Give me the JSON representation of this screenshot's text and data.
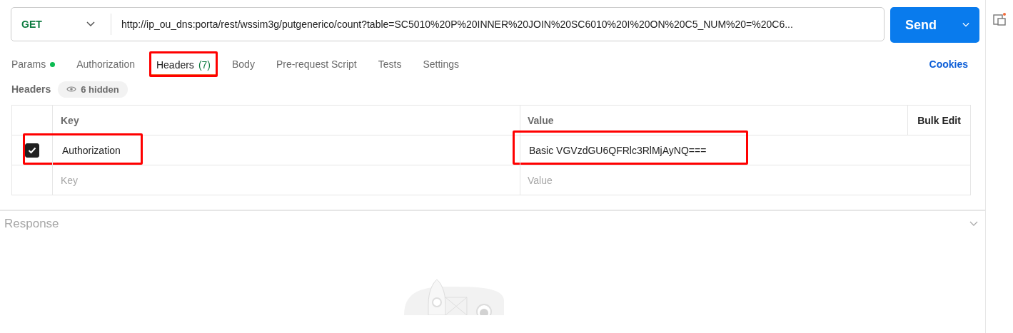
{
  "request": {
    "method": "GET",
    "url": "http://ip_ou_dns:porta/rest/wssim3g/putgenerico/count?table=SC5010%20P%20INNER%20JOIN%20SC6010%20I%20ON%20C5_NUM%20=%20C6...",
    "send": "Send"
  },
  "tabs": [
    {
      "label": "Params",
      "dot": true,
      "selected": false
    },
    {
      "label": "Authorization",
      "dot": false,
      "selected": false
    },
    {
      "label": "Headers",
      "count": "(7)",
      "dot": false,
      "selected": true,
      "highlighted": true
    },
    {
      "label": "Body",
      "dot": false,
      "selected": false
    },
    {
      "label": "Pre-request Script",
      "dot": false,
      "selected": false
    },
    {
      "label": "Tests",
      "dot": false,
      "selected": false
    },
    {
      "label": "Settings",
      "dot": false,
      "selected": false
    }
  ],
  "cookies": "Cookies",
  "headers": {
    "title": "Headers",
    "hidden": "6 hidden",
    "columns": [
      "Key",
      "Value"
    ],
    "bulk_edit": "Bulk Edit",
    "rows": [
      {
        "checked": true,
        "key": "Authorization",
        "value": "Basic VGVzdGU6QFRlc3RlMjAyNQ===",
        "highlighted": true
      }
    ],
    "key_field": {
      "placeholder": "Key"
    },
    "value_field": {
      "placeholder": "Value"
    }
  },
  "response": {
    "title": "Response"
  }
}
